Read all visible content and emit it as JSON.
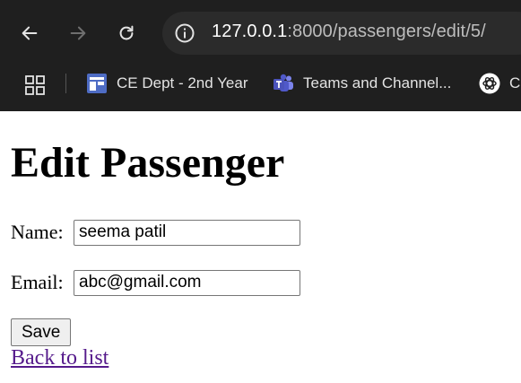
{
  "browser": {
    "url_host": "127.0.0.1",
    "url_rest": ":8000/passengers/edit/5/",
    "icons": {
      "back": "arrow-left-icon",
      "forward": "arrow-right-icon",
      "reload": "reload-icon",
      "site_info": "info-icon",
      "apps": "apps-grid-icon"
    },
    "bookmarks": [
      {
        "label": "CE Dept - 2nd Year",
        "icon": "calendar-icon",
        "color": "#4e6cc4"
      },
      {
        "label": "Teams and Channel...",
        "icon": "teams-icon",
        "color": "#7b83eb"
      },
      {
        "label": "Cl",
        "icon": "chatgpt-icon",
        "color": "#ffffff"
      }
    ]
  },
  "page": {
    "title": "Edit Passenger",
    "name_label": "Name:",
    "name_value": "seema patil",
    "email_label": "Email:",
    "email_value": "abc@gmail.com",
    "save_label": "Save",
    "back_link": "Back to list"
  },
  "colors": {
    "chrome_bg": "#1f1f1f",
    "omnibox_bg": "#2b2b2b",
    "visited_link": "#551a8b"
  }
}
